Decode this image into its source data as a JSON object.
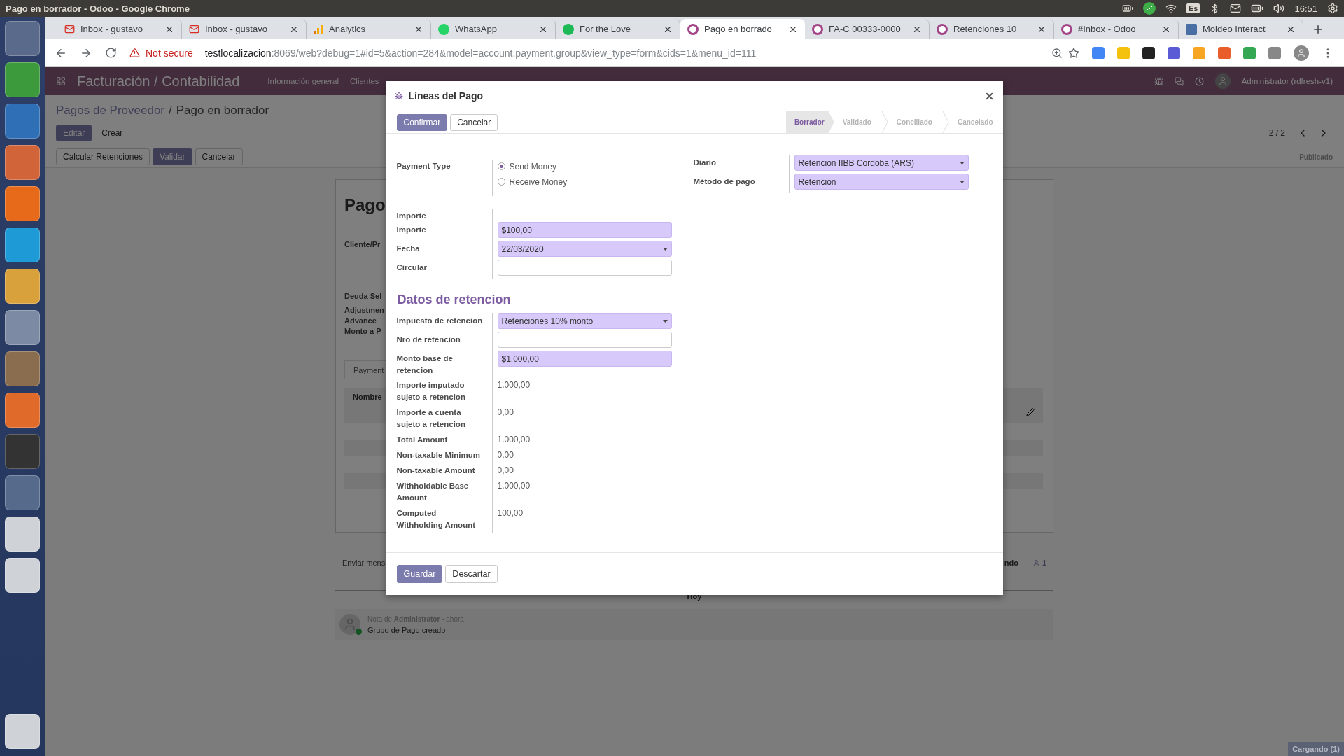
{
  "os_bar": {
    "window_title": "Pago en borrador - Odoo - Google Chrome",
    "keyboard_layout": "Es",
    "time": "16:51"
  },
  "browser": {
    "tabs": [
      {
        "kind": "mail",
        "title": "Inbox - gustavo",
        "selected": false
      },
      {
        "kind": "mail",
        "title": "Inbox - gustavo",
        "selected": false
      },
      {
        "kind": "analytics",
        "title": "Analytics",
        "selected": false
      },
      {
        "kind": "whatsapp",
        "title": "WhatsApp",
        "selected": false
      },
      {
        "kind": "music",
        "title": "For the Love",
        "selected": false
      },
      {
        "kind": "odoo",
        "title": "Pago en borrado",
        "selected": true
      },
      {
        "kind": "odoo",
        "title": "FA-C 00333-0000",
        "selected": false
      },
      {
        "kind": "odoo",
        "title": "Retenciones 10",
        "selected": false
      },
      {
        "kind": "odoo",
        "title": "#Inbox - Odoo",
        "selected": false
      },
      {
        "kind": "page",
        "title": "Moldeo Interact",
        "selected": false
      }
    ],
    "address": {
      "security": "Not secure",
      "host": "testlocalizacion",
      "path": ":8069/web?debug=1#id=5&action=284&model=account.payment.group&view_type=form&cids=1&menu_id=111"
    }
  },
  "navbar": {
    "app": "Facturación / Contabilidad",
    "menu": [
      "Información general",
      "Clientes"
    ],
    "user": "Administrator (rdfresh-v1)"
  },
  "control_panel": {
    "breadcrumb": {
      "items": [
        "Pagos de Proveedor",
        "Pago en borrador"
      ],
      "separator": "/"
    },
    "buttons": [
      {
        "label": "Editar",
        "primary": true
      },
      {
        "label": "Crear",
        "primary": false
      }
    ],
    "pager": "2 / 2",
    "actions": [
      {
        "label": "Calcular Retenciones",
        "primary": false
      },
      {
        "label": "Validar",
        "primary": true
      },
      {
        "label": "Cancelar",
        "primary": false
      }
    ],
    "status": "Publicado"
  },
  "sheet": {
    "title": "Pago",
    "fields": [
      "Cliente/Pr",
      "Deuda Sel",
      "Adjustmen",
      "Advance",
      "Monto a P"
    ],
    "tab": "Payment",
    "column": "Nombre"
  },
  "chatter": {
    "send_message": "Enviar mens",
    "follow": "ndo",
    "followers": "1",
    "day": "Hoy",
    "messages": [
      {
        "header": "Nota de **Administrator** - ahora",
        "body": "Grupo de Pago creado"
      }
    ]
  },
  "loading": "Cargando (1)",
  "dialog": {
    "title": "Líneas del Pago",
    "header_buttons": [
      {
        "label": "Confirmar",
        "primary": true
      },
      {
        "label": "Cancelar",
        "primary": false
      }
    ],
    "stages": [
      {
        "label": "Borrador",
        "selected": true
      },
      {
        "label": "Validado",
        "selected": false
      },
      {
        "label": "Conciliado",
        "selected": false
      },
      {
        "label": "Cancelado",
        "selected": false
      }
    ],
    "payment_type": {
      "label": "Payment Type",
      "options": [
        {
          "label": "Send Money",
          "selected": true
        },
        {
          "label": "Receive Money",
          "selected": false
        }
      ]
    },
    "right_fields": [
      {
        "label": "Diario",
        "kind": "select",
        "value": "Retencion IIBB Cordoba (ARS)",
        "required": true
      },
      {
        "label": "Método de pago",
        "kind": "select",
        "value": "Retención",
        "required": true
      }
    ],
    "amount_group": {
      "heading": "Importe",
      "fields": [
        {
          "label": "Importe",
          "kind": "input",
          "value": "$100,00",
          "required": true
        },
        {
          "label": "Fecha",
          "kind": "select",
          "value": "22/03/2020",
          "required": true
        },
        {
          "label": "Circular",
          "kind": "input",
          "required": false
        }
      ]
    },
    "section": "Datos de retencion",
    "withholding_fields": [
      {
        "label": "Impuesto de retencion",
        "kind": "select",
        "value": "Retenciones 10% monto",
        "required": true
      },
      {
        "label": "Nro de retencion",
        "kind": "input",
        "required": false
      },
      {
        "label": "Monto base de retencion",
        "kind": "input",
        "value": "$1.000,00",
        "required": true
      },
      {
        "label": "Importe imputado sujeto a retencion",
        "kind": "readonly",
        "value": "1.000,00"
      },
      {
        "label": "Importe a cuenta sujeto a retencion",
        "kind": "readonly",
        "value": "0,00"
      },
      {
        "label": "Total Amount",
        "kind": "readonly",
        "value": "1.000,00"
      },
      {
        "label": "Non-taxable Minimum",
        "kind": "readonly",
        "value": "0,00"
      },
      {
        "label": "Non-taxable Amount",
        "kind": "readonly",
        "value": "0,00"
      },
      {
        "label": "Withholdable Base Amount",
        "kind": "readonly",
        "value": "1.000,00"
      },
      {
        "label": "Computed Withholding Amount",
        "kind": "readonly",
        "value": "100,00"
      }
    ],
    "footer_buttons": [
      {
        "label": "Guardar",
        "primary": true
      },
      {
        "label": "Descartar",
        "primary": false
      }
    ]
  }
}
